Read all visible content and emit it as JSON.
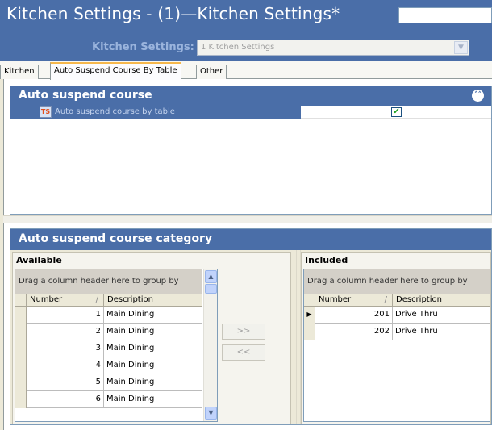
{
  "window": {
    "title": "Kitchen Settings - (1)—Kitchen Settings*",
    "title_search_value": ""
  },
  "selector": {
    "label": "Kitchen Settings:",
    "value": "1 Kitchen Settings",
    "dropdown_icon": "chevron-down-icon"
  },
  "tabs": [
    {
      "label": "Kitchen",
      "active": false
    },
    {
      "label": "Auto Suspend Course By Table",
      "active": true
    },
    {
      "label": "Other",
      "active": false
    }
  ],
  "auto_suspend": {
    "header": "Auto suspend course",
    "collapse_icon": "double-chevron-up-icon",
    "property": {
      "icon": "ts-option-icon",
      "icon_text": "TS",
      "label": "Auto suspend course by table",
      "checked": true,
      "check_glyph": "✔"
    }
  },
  "category": {
    "header": "Auto suspend course category",
    "available": {
      "title": "Available",
      "group_hint": "Drag a column header here to group by",
      "columns": [
        "Number",
        "Description"
      ],
      "sort_glyph": "/",
      "rows": [
        {
          "number": "1",
          "description": "Main Dining"
        },
        {
          "number": "2",
          "description": "Main Dining"
        },
        {
          "number": "3",
          "description": "Main Dining"
        },
        {
          "number": "4",
          "description": "Main Dining"
        },
        {
          "number": "5",
          "description": "Main Dining"
        },
        {
          "number": "6",
          "description": "Main Dining"
        }
      ]
    },
    "buttons": {
      "add": ">>",
      "remove": "<<"
    },
    "included": {
      "title": "Included",
      "group_hint": "Drag a column header here to group by",
      "columns": [
        "Number",
        "Description"
      ],
      "sort_glyph": "/",
      "current_row_glyph": "▶",
      "rows": [
        {
          "number": "201",
          "description": "Drive Thru"
        },
        {
          "number": "202",
          "description": "Drive Thru"
        }
      ]
    }
  },
  "colors": {
    "accent": "#4a6ea8",
    "tab_highlight": "#f6b84c"
  }
}
